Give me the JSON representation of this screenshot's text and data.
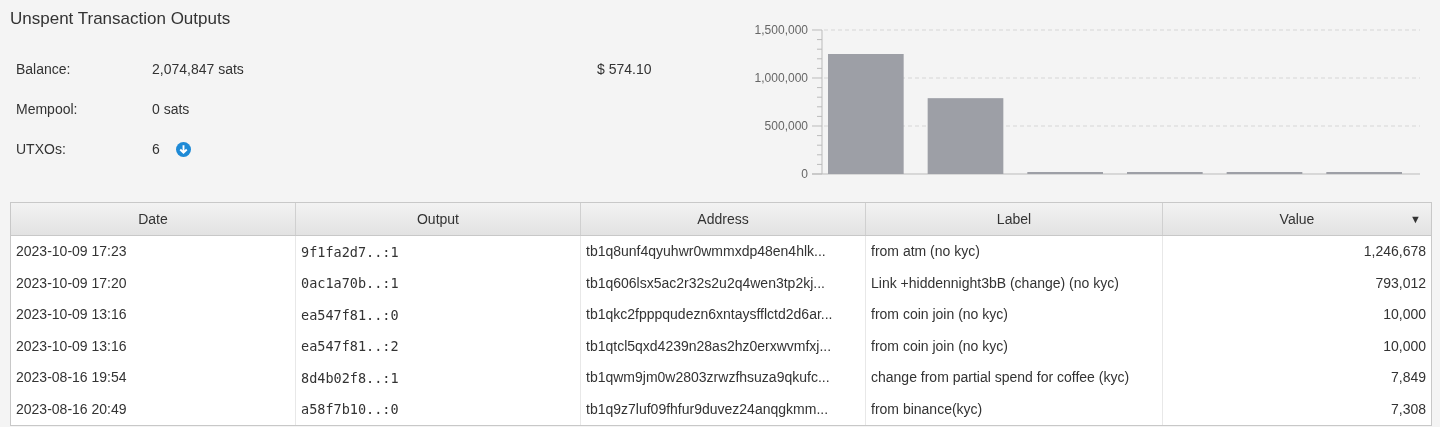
{
  "title": "Unspent Transaction Outputs",
  "summary": [
    {
      "label": "Balance:",
      "value": "2,074,847 sats",
      "fiat": "$ 574.10"
    },
    {
      "label": "Mempool:",
      "value": "0 sats"
    },
    {
      "label": "UTXOs:",
      "value": "6",
      "action": true
    }
  ],
  "chart_data": {
    "type": "bar",
    "values": [
      1250000,
      790000,
      10000,
      10000,
      8000,
      7000
    ],
    "ylim": [
      0,
      1500000
    ],
    "yticks": [
      {
        "value": 0,
        "label": "0"
      },
      {
        "value": 500000,
        "label": "500,000"
      },
      {
        "value": 1000000,
        "label": "1,000,000"
      },
      {
        "value": 1500000,
        "label": "1,500,000"
      }
    ]
  },
  "table": {
    "columns": [
      {
        "label": "Date"
      },
      {
        "label": "Output"
      },
      {
        "label": "Address"
      },
      {
        "label": "Label"
      },
      {
        "label": "Value",
        "sort_indicator": "▼"
      }
    ],
    "rows": [
      [
        "2023-10-09 17:23",
        "9f1fa2d7..:1",
        "tb1q8unf4qyuhwr0wmmxdp48en4hlk...",
        "from atm (no kyc)",
        "1,246,678"
      ],
      [
        "2023-10-09 17:20",
        "0ac1a70b..:1",
        "tb1q606lsx5ac2r32s2u2q4wen3tp2kj...",
        "Link +hiddennight3bB (change) (no kyc)",
        "793,012"
      ],
      [
        "2023-10-09 13:16",
        "ea547f81..:0",
        "tb1qkc2fpppqudezn6xntaysfflctd2d6ar...",
        "from coin join (no kyc)",
        "10,000"
      ],
      [
        "2023-10-09 13:16",
        "ea547f81..:2",
        "tb1qtcl5qxd4239n28as2hz0erxwvmfxj...",
        "from coin join (no kyc)",
        "10,000"
      ],
      [
        "2023-08-16 19:54",
        "8d4b02f8..:1",
        "tb1qwm9jm0w2803zrwzfhsuza9qkufc...",
        "change from partial spend for coffee (kyc)",
        "7,849"
      ],
      [
        "2023-08-16 20:49",
        "a58f7b10..:0",
        "tb1q9z7luf09fhfur9duvez24anqgkmm...",
        "from binance(kyc)",
        "7,308"
      ]
    ]
  }
}
